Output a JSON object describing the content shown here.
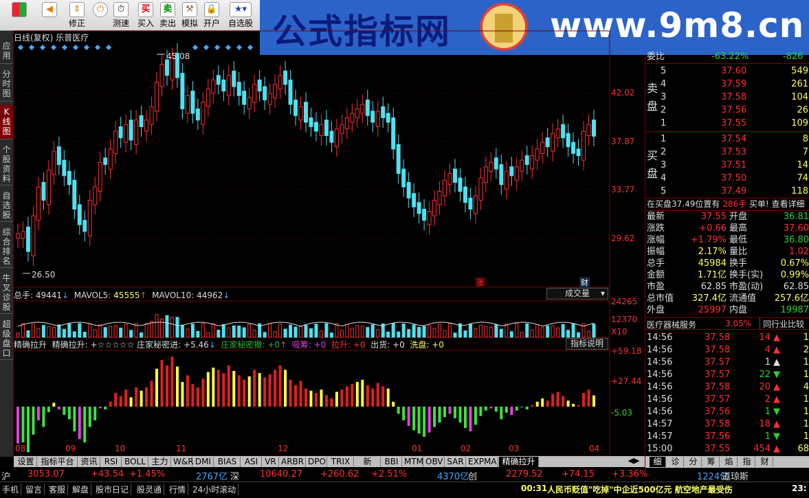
{
  "toolbar": {
    "buttons": [
      {
        "label": "",
        "icon": "windows-icon"
      },
      {
        "label": "",
        "icon": "back-arrow-icon"
      },
      {
        "label": "修正",
        "icon": "up-down-icon"
      },
      {
        "label": "测速",
        "icon": "stopwatch-icon"
      },
      {
        "label": "买入",
        "icon": "buy-icon"
      },
      {
        "label": "卖出",
        "icon": "sell-icon"
      },
      {
        "label": "模拟",
        "icon": "hammer-icon"
      },
      {
        "label": "开户",
        "icon": "lock-icon"
      },
      {
        "label": "自选股",
        "icon": "star-list-icon"
      }
    ],
    "buy_glyph": "买",
    "sell_glyph": "卖"
  },
  "banner": {
    "title": "公式指标网",
    "url": "www.9m8.cn"
  },
  "left_tabs": [
    "应用",
    "分时图",
    "K线图",
    "个股资料",
    "自选股",
    "综合排名",
    "牛叉诊股",
    "超级盘口"
  ],
  "chart": {
    "title": "日线(复权)  乐普医疗",
    "price_labels": [
      "42.02",
      "37.87",
      "33.77",
      "29.62"
    ],
    "high_label": "45.08",
    "low_label": "26.50",
    "zhang": "涨",
    "cai": "财",
    "volume": {
      "total_label": "总手: ",
      "total": "49441",
      "ma5_label": "MAVOL5: ",
      "ma5": "45555",
      "ma10_label": "MAVOL10: ",
      "ma10": "44962",
      "dropdown": "成交量",
      "axis": [
        "24265",
        "12370",
        "X10"
      ]
    },
    "indicator": {
      "name": "精确拉升",
      "legend": "精确拉升: +☆☆☆☆☆ 庄家秘密进: +5.46",
      "l2": "庄家秘密撤: +0",
      "l3": "吸筹: +0",
      "l4": "拉升: +0",
      "l5": "出货: +0",
      "l6": "洗盘: +0",
      "button": "指标说明",
      "axis": [
        "+59.18",
        "+27.44",
        "-5.03"
      ]
    },
    "months": [
      "08",
      "09",
      "10",
      "11",
      "12",
      "01",
      "02",
      "03",
      "04"
    ]
  },
  "chart_data": {
    "type": "candlestick",
    "title": "日线(复权)  乐普医疗",
    "candles": [
      28.8,
      29.0,
      27.2,
      30.4,
      33.0,
      31.8,
      34.5,
      36.2,
      35.0,
      34.0,
      33.2,
      31.0,
      29.6,
      29.0,
      31.8,
      33.0,
      35.2,
      35.0,
      36.4,
      38.0,
      37.4,
      38.6,
      37.2,
      39.0,
      38.4,
      39.0,
      40.2,
      42.4,
      44.0,
      43.0,
      44.6,
      42.8,
      40.0,
      41.2,
      39.6,
      39.0,
      40.6,
      41.8,
      42.6,
      42.2,
      41.6,
      43.0,
      42.0,
      41.2,
      40.4,
      41.0,
      42.2,
      41.6,
      40.8,
      41.4,
      42.2,
      43.0,
      42.2,
      40.4,
      39.4,
      40.2,
      38.8,
      38.4,
      38.0,
      38.6,
      37.6,
      37.0,
      38.2,
      38.6,
      39.2,
      39.6,
      40.0,
      40.4,
      39.4,
      38.8,
      39.8,
      39.2,
      38.8,
      36.4,
      34.2,
      33.0,
      32.0,
      31.2,
      30.6,
      30.0,
      30.8,
      31.8,
      32.6,
      33.6,
      34.2,
      33.4,
      32.6,
      31.6,
      31.0,
      32.2,
      33.8,
      34.8,
      35.2,
      34.6,
      33.2,
      34.4,
      34.0,
      34.8,
      35.4,
      35.0,
      35.8,
      36.4,
      37.0,
      36.6,
      37.8,
      38.2,
      37.4,
      36.6,
      36.0,
      35.8,
      38.0,
      38.6,
      37.55
    ],
    "volume_axis": [
      "24265",
      "12370"
    ],
    "indicator_axis": [
      "+59.18",
      "+27.44",
      "-5.03"
    ]
  },
  "orderbook": {
    "wei_label": "委比",
    "wei_val": "-63.22%",
    "wei_diff": "-826",
    "sell_label": "卖盘",
    "buy_label": "买盘",
    "sells": [
      {
        "n": "5",
        "p": "37.60",
        "v": "549"
      },
      {
        "n": "4",
        "p": "37.59",
        "v": "261"
      },
      {
        "n": "3",
        "p": "37.58",
        "v": "104"
      },
      {
        "n": "2",
        "p": "37.56",
        "v": "26"
      },
      {
        "n": "1",
        "p": "37.55",
        "v": "109"
      }
    ],
    "buys": [
      {
        "n": "1",
        "p": "37.54",
        "v": "8"
      },
      {
        "n": "2",
        "p": "37.53",
        "v": "7"
      },
      {
        "n": "3",
        "p": "37.51",
        "v": "14"
      },
      {
        "n": "4",
        "p": "37.50",
        "v": "74"
      },
      {
        "n": "5",
        "p": "37.49",
        "v": "118"
      }
    ],
    "notice": "在买盘37.49位置有",
    "notice_vol": "286手",
    "notice_tail": "买单! 查看详细"
  },
  "stats": [
    {
      "k1": "最新",
      "v1": "37.55",
      "k2": "开盘",
      "v2": "36.81",
      "c1": "#ff3030",
      "c2": "#30d030"
    },
    {
      "k1": "涨跌",
      "v1": "+0.66",
      "k2": "最高",
      "v2": "37.60",
      "c1": "#ff3030",
      "c2": "#ff3030"
    },
    {
      "k1": "涨幅",
      "v1": "+1.79%",
      "k2": "最低",
      "v2": "36.80",
      "c1": "#ff3030",
      "c2": "#30d030"
    },
    {
      "k1": "振幅",
      "v1": "2.17%",
      "k2": "量比",
      "v2": "1.02",
      "c1": "#ffff60",
      "c2": "#ff3030"
    },
    {
      "k1": "总手",
      "v1": "45984",
      "k2": "换手",
      "v2": "0.67%",
      "c1": "#ffff60",
      "c2": "#ffff60"
    },
    {
      "k1": "金额",
      "v1": "1.71亿",
      "k2": "换手(实)",
      "v2": "0.99%",
      "c1": "#ffff60",
      "c2": "#ffff60"
    },
    {
      "k1": "市盈",
      "v1": "62.85",
      "k2": "市盈(动)",
      "v2": "62.85",
      "c1": "#dddddd",
      "c2": "#dddddd"
    },
    {
      "k1": "总市值",
      "v1": "327.4亿",
      "k2": "流通值",
      "v2": "257.6亿",
      "c1": "#ffff60",
      "c2": "#ffff60"
    },
    {
      "k1": "外盘",
      "v1": "25997",
      "k2": "内盘",
      "v2": "19987",
      "c1": "#ff3030",
      "c2": "#30d030"
    }
  ],
  "sector": {
    "name": "医疗器械服务",
    "pct": "3.05%",
    "compare": "同行业比较"
  },
  "ticks": [
    {
      "t": "14:56",
      "p": "37.58",
      "v": "14",
      "d": "up",
      "e": "1",
      "pc": "#ff3030"
    },
    {
      "t": "14:56",
      "p": "37.58",
      "v": "4",
      "d": "up",
      "e": "2",
      "pc": "#ff3030"
    },
    {
      "t": "14:56",
      "p": "37.57",
      "v": "1",
      "d": "eq",
      "e": "1",
      "pc": "#ff3030"
    },
    {
      "t": "14:56",
      "p": "37.57",
      "v": "22",
      "d": "down",
      "e": "1",
      "pc": "#ff3030"
    },
    {
      "t": "14:56",
      "p": "37.58",
      "v": "20",
      "d": "up",
      "e": "4",
      "pc": "#ff3030"
    },
    {
      "t": "14:56",
      "p": "37.57",
      "v": "2",
      "d": "up",
      "e": "1",
      "pc": "#ff3030"
    },
    {
      "t": "14:56",
      "p": "37.56",
      "v": "1",
      "d": "down",
      "e": "1",
      "pc": "#ff3030"
    },
    {
      "t": "14:57",
      "p": "37.58",
      "v": "18",
      "d": "up",
      "e": "1",
      "pc": "#ff3030"
    },
    {
      "t": "14:57",
      "p": "37.56",
      "v": "1",
      "d": "down",
      "e": "1",
      "pc": "#ff3030"
    },
    {
      "t": "15:00",
      "p": "37.55",
      "v": "454",
      "d": "up",
      "e": "68",
      "pc": "#ff3030"
    }
  ],
  "right_tabs": [
    "细",
    "诊",
    "分",
    "筹",
    "焰",
    "指",
    "财"
  ],
  "bottom_tabs": [
    "设置",
    "指标平台",
    "资讯",
    "RSI",
    "BOLL",
    "主力",
    "W&R",
    "DMI",
    "BIAS",
    "ASI",
    "VR",
    "ARBR",
    "DPO",
    "TRIX",
    "新DMA",
    "BBI",
    "MTM",
    "OBV",
    "SAR",
    "EXPMA",
    "精确拉升"
  ],
  "market": [
    {
      "name": "沪",
      "val": "3053.07",
      "chg": "+43.54",
      "pct": "+1.45%",
      "amt": "2767亿"
    },
    {
      "name": "深",
      "val": "10640.27",
      "chg": "+260.62",
      "pct": "+2.51%",
      "amt": "4370亿"
    },
    {
      "name": "创",
      "val": "2279.52",
      "chg": "+74.15",
      "pct": "+3.36%",
      "amt": "1224亿"
    },
    {
      "name": "道琼斯",
      "val": "",
      "chg": "",
      "pct": "",
      "amt": ""
    }
  ],
  "taskbar": {
    "items": [
      "手机",
      "留言",
      "客服",
      "解盘",
      "股市日记",
      "股灵通",
      "行情",
      "24小时滚动"
    ],
    "time": "00:31",
    "news": "人民币贬值\"吃掉\"中企近500亿元  航空地产最受伤",
    "clock": "23:"
  }
}
